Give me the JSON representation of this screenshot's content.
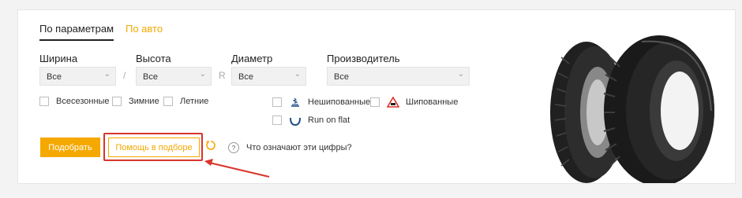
{
  "tabs": [
    {
      "label": "По параметрам",
      "active": true
    },
    {
      "label": "По авто",
      "active": false
    }
  ],
  "fields": {
    "width": {
      "label": "Ширина",
      "value": "Все"
    },
    "height": {
      "label": "Высота",
      "value": "Все"
    },
    "diameter": {
      "label": "Диаметр",
      "value": "Все"
    },
    "manufacturer": {
      "label": "Производитель",
      "value": "Все"
    }
  },
  "separators": {
    "slash": "/",
    "r": "R"
  },
  "seasons": [
    {
      "label": "Всесезонные",
      "checked": false
    },
    {
      "label": "Зимние",
      "checked": false
    },
    {
      "label": "Летние",
      "checked": false
    }
  ],
  "options": [
    {
      "label": "Нешипованные",
      "icon": "non-studded-icon",
      "checked": false
    },
    {
      "label": "Шипованные",
      "icon": "studded-icon",
      "checked": false
    },
    {
      "label": "Run on flat",
      "icon": "run-flat-icon",
      "checked": false
    }
  ],
  "actions": {
    "submit": "Подобрать",
    "help_select": "Помощь в подборе",
    "reset_icon": "reset-icon",
    "help_link": "Что означают эти цифры?",
    "help_icon": "?"
  },
  "colors": {
    "accent": "#f5a800",
    "highlight": "#d9342b"
  }
}
